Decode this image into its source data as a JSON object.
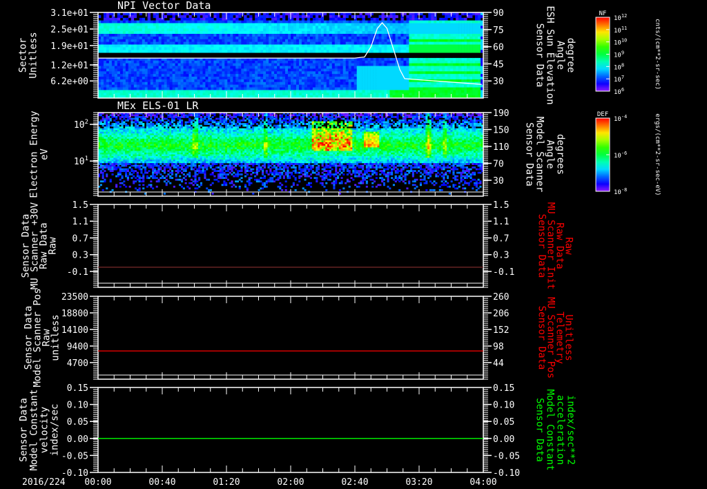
{
  "chart_data": [
    {
      "type": "heatmap",
      "title": "NPI Vector Data",
      "left_axis": {
        "label": [
          "Sector",
          "Unitless"
        ],
        "ylim": [
          0,
          31
        ],
        "scale": "linear",
        "ticks": [
          31,
          25,
          19,
          12,
          6.2
        ],
        "tick_labels": [
          "3.1e+01",
          "2.5e+01",
          "1.9e+01",
          "1.2e+01",
          "6.2e+00"
        ],
        "color": "#ffffff"
      },
      "right_axis": {
        "label": [
          "Sensor Data",
          "ESH Sun Elevation",
          "Angle",
          "degree"
        ],
        "ylim": [
          15,
          90
        ],
        "scale": "linear",
        "ticks": [
          90,
          75,
          60,
          45,
          30
        ],
        "tick_labels": [
          "90",
          "75",
          "60",
          "45",
          "30"
        ],
        "color": "#ffffff"
      },
      "colorbar": {
        "title": "NF",
        "units": "cnts/(cm**2-sr-sec)",
        "scale": "log",
        "tick_labels": [
          "10^12",
          "10^11",
          "10^10",
          "10^9",
          "10^8",
          "10^7",
          "10^6"
        ]
      },
      "line_series": {
        "axis": "right",
        "color": "#ffffff",
        "points": [
          [
            "00:00",
            50
          ],
          [
            "02:40",
            50
          ],
          [
            "02:46",
            51
          ],
          [
            "02:50",
            60
          ],
          [
            "02:54",
            76
          ],
          [
            "02:57",
            81
          ],
          [
            "03:00",
            76
          ],
          [
            "03:04",
            58
          ],
          [
            "03:08",
            40
          ],
          [
            "03:11",
            32
          ],
          [
            "03:20",
            31
          ],
          [
            "03:40",
            29
          ],
          [
            "03:59",
            27
          ]
        ]
      }
    },
    {
      "type": "heatmap",
      "title": "MEx ELS-01 LR",
      "left_axis": {
        "label": [
          "Electron Energy",
          "eV"
        ],
        "ylim": [
          1.1,
          210
        ],
        "scale": "log",
        "ticks": [
          100,
          10
        ],
        "tick_labels": [
          "10^2",
          "10^1"
        ],
        "color": "#ffffff"
      },
      "right_axis": {
        "label": [
          "Sensor Data",
          "Model Scanner",
          "Angle",
          "degrees"
        ],
        "ylim": [
          -7.5,
          190
        ],
        "scale": "linear",
        "ticks": [
          190,
          150,
          110,
          70,
          30
        ],
        "tick_labels": [
          "190",
          "150",
          "110",
          "70",
          "30"
        ],
        "color": "#ffffff"
      },
      "colorbar": {
        "title": "DEF",
        "units": "ergs/(cm**2-sr-sec-eV)",
        "scale": "log",
        "tick_labels": [
          "10^-4",
          "10^-6",
          "10^-8"
        ]
      }
    },
    {
      "type": "line",
      "left_axis": {
        "label": [
          "Sensor Data",
          "MU Scanner +30V",
          "Raw Data",
          "Raw"
        ],
        "ylim": [
          -0.48,
          1.5
        ],
        "scale": "linear",
        "ticks": [
          1.5,
          1.1,
          0.7,
          0.3,
          -0.1
        ],
        "tick_labels": [
          "1.5",
          "1.1",
          "0.7",
          "0.3",
          "-0.1"
        ],
        "color": "#ffffff"
      },
      "right_axis": {
        "label": [
          "Sensor Data",
          "MU Scanner Init",
          "Raw Data",
          "Raw"
        ],
        "ylim": [
          -0.48,
          1.5
        ],
        "scale": "linear",
        "ticks": [
          1.5,
          1.1,
          0.7,
          0.3,
          -0.1
        ],
        "tick_labels": [
          "1.5",
          "1.1",
          "0.7",
          "0.3",
          "-0.1"
        ],
        "color": "#ff0000"
      },
      "line_series": {
        "axis": "right",
        "color": "#7a2a2a",
        "points": [
          [
            "00:00",
            0.0
          ],
          [
            "04:00",
            0.0
          ]
        ]
      }
    },
    {
      "type": "line",
      "left_axis": {
        "label": [
          "Sensor Data",
          "Model Scanner Pos",
          "Raw",
          "unitless"
        ],
        "ylim": [
          0,
          23500
        ],
        "scale": "linear",
        "ticks": [
          23500,
          18800,
          14100,
          9400,
          4700
        ],
        "tick_labels": [
          "23500",
          "18800",
          "14100",
          "9400",
          "4700"
        ],
        "color": "#ffffff"
      },
      "right_axis": {
        "label": [
          "Sensor Data",
          "MU Scanner Pos",
          "Telemetry",
          "Unitless"
        ],
        "ylim": [
          -10,
          260
        ],
        "scale": "linear",
        "ticks": [
          260,
          206,
          152,
          98,
          44
        ],
        "tick_labels": [
          "260",
          "206",
          "152",
          "98",
          "44"
        ],
        "color": "#ff0000"
      },
      "line_series": {
        "axis": "right",
        "color": "#ff0000",
        "points": [
          [
            "00:00",
            82
          ],
          [
            "04:00",
            82
          ]
        ]
      }
    },
    {
      "type": "line",
      "left_axis": {
        "label": [
          "Sensor Data",
          "Model Constant",
          "velocity",
          "index/sec"
        ],
        "ylim": [
          -0.1,
          0.15
        ],
        "scale": "linear",
        "ticks": [
          0.15,
          0.1,
          0.05,
          0.0,
          -0.05,
          -0.1
        ],
        "tick_labels": [
          "0.15",
          "0.10",
          "0.05",
          "0.00",
          "-0.05",
          "-0.10"
        ],
        "color": "#ffffff"
      },
      "right_axis": {
        "label": [
          "Sensor Data",
          "Model Constant",
          "acceleration",
          "index/sec**2"
        ],
        "ylim": [
          -0.1,
          0.15
        ],
        "scale": "linear",
        "ticks": [
          0.15,
          0.1,
          0.05,
          0.0,
          -0.05,
          -0.1
        ],
        "tick_labels": [
          "0.15",
          "0.10",
          "0.05",
          "0.00",
          "-0.05",
          "-0.10"
        ],
        "color": "#00ff00"
      },
      "line_series": {
        "axis": "right",
        "color": "#00ff00",
        "points": [
          [
            "00:00",
            0.0
          ],
          [
            "04:00",
            0.0
          ]
        ]
      }
    }
  ],
  "time_axis": {
    "date": "2016/224",
    "range": [
      "00:00",
      "04:00"
    ],
    "tick_labels": [
      "00:00",
      "00:40",
      "01:20",
      "02:00",
      "02:40",
      "03:20",
      "04:00"
    ],
    "minor_step_minutes": 10
  }
}
